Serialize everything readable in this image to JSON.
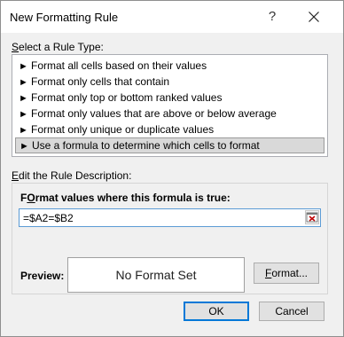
{
  "window": {
    "title": "New Formatting Rule",
    "help_glyph": "?"
  },
  "rule_type": {
    "label_prefix": "",
    "label_hotkey": "S",
    "label_rest": "elect a Rule Type:",
    "items": [
      {
        "label": "Format all cells based on their values",
        "selected": false
      },
      {
        "label": "Format only cells that contain",
        "selected": false
      },
      {
        "label": "Format only top or bottom ranked values",
        "selected": false
      },
      {
        "label": "Format only values that are above or below average",
        "selected": false
      },
      {
        "label": "Format only unique or duplicate values",
        "selected": false
      },
      {
        "label": "Use a formula to determine which cells to format",
        "selected": true
      }
    ],
    "arrow_glyph": "►"
  },
  "description": {
    "label_prefix": "",
    "label_hotkey": "E",
    "label_rest": "dit the Rule Description:",
    "heading_hotkey": "O",
    "heading_prefix": "F",
    "heading_rest": "rmat values where this formula is true:",
    "formula_value": "=$A2=$B2",
    "preview_label": "Preview:",
    "preview_text": "No Format Set",
    "format_button_hotkey": "F",
    "format_button_rest": "ormat..."
  },
  "footer": {
    "ok_label": "OK",
    "cancel_label": "Cancel"
  },
  "colors": {
    "focus_border": "#0078d7",
    "formula_border": "#5b9bd5",
    "selected_item_bg": "#d9d9d9"
  },
  "icons": [
    "close-icon",
    "help-icon",
    "collapse-dialog-icon",
    "arrow-icon"
  ]
}
